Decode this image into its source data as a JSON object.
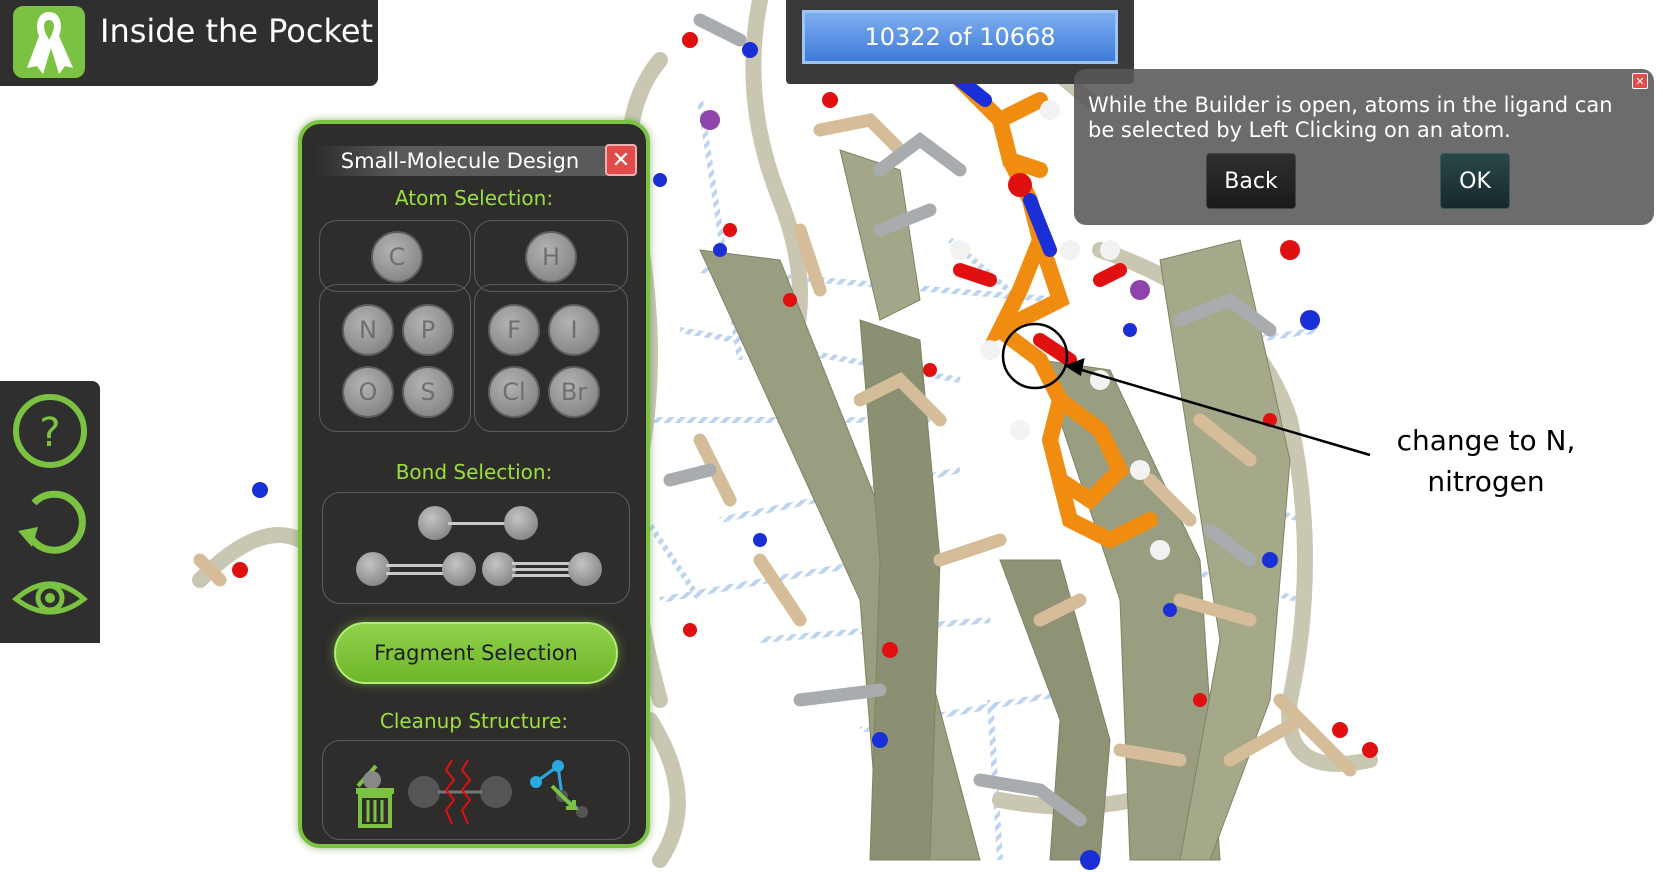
{
  "app": {
    "title": "Inside the Pocket",
    "logo_icon": "ribbon-icon",
    "accent_color": "#7cc242"
  },
  "counter": {
    "text": "10322 of 10668"
  },
  "side_toolbar": {
    "items": [
      {
        "icon": "help-icon"
      },
      {
        "icon": "reset-icon"
      },
      {
        "icon": "eye-icon"
      }
    ]
  },
  "design_panel": {
    "title": "Small-Molecule Design",
    "close_icon": "close-icon",
    "atom_selection_label": "Atom Selection:",
    "atoms": [
      "C",
      "H",
      "N",
      "P",
      "F",
      "I",
      "O",
      "S",
      "Cl",
      "Br"
    ],
    "bond_selection_label": "Bond Selection:",
    "bonds": [
      "single-bond",
      "double-bond",
      "triple-bond"
    ],
    "fragment_button": "Fragment Selection",
    "cleanup_label": "Cleanup Structure:",
    "cleanup_tools": [
      "delete-atom-icon",
      "break-bond-icon",
      "clean-structure-icon"
    ]
  },
  "popup": {
    "message": "While the Builder is open, atoms in the ligand can be selected by Left Clicking on an atom.",
    "back_label": "Back",
    "ok_label": "OK"
  },
  "annotation": {
    "line1": "change to N,",
    "line2": "nitrogen"
  },
  "colors": {
    "ligand_carbon": "#f08c10",
    "oxygen": "#e01010",
    "nitrogen": "#1a2fd6",
    "hydrogen": "#f2f2f2",
    "protein_strand": "#9a9e80",
    "sidechain": "#d8bf9c"
  }
}
